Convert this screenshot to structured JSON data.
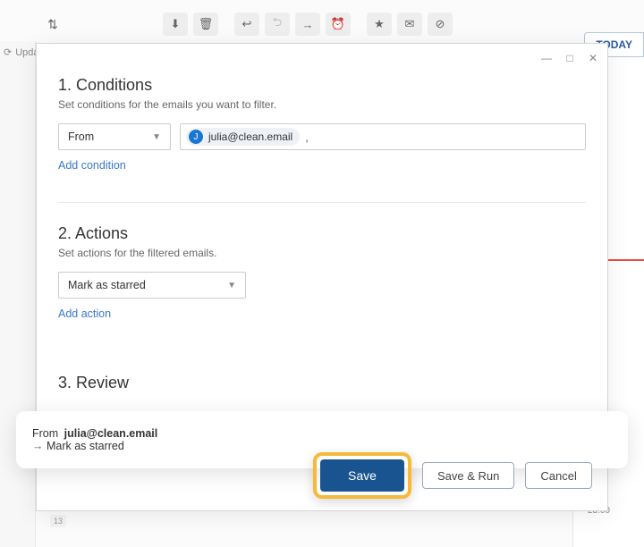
{
  "bg": {
    "updating": "Updating…",
    "today": "TODAY",
    "time": "23:00",
    "day": "13"
  },
  "dialog": {
    "conditions": {
      "title": "1. Conditions",
      "subtitle": "Set conditions for the emails you want to filter.",
      "field": "From",
      "chip": {
        "initial": "J",
        "email": "julia@clean.email"
      },
      "add": "Add condition"
    },
    "actions": {
      "title": "2. Actions",
      "subtitle": "Set actions for the filtered emails.",
      "selected": "Mark as starred",
      "add": "Add action"
    },
    "review": {
      "title": "3. Review"
    }
  },
  "footer": {
    "from_label": "From",
    "email": "julia@clean.email",
    "action": "Mark as starred"
  },
  "buttons": {
    "save": "Save",
    "save_run": "Save & Run",
    "cancel": "Cancel"
  }
}
